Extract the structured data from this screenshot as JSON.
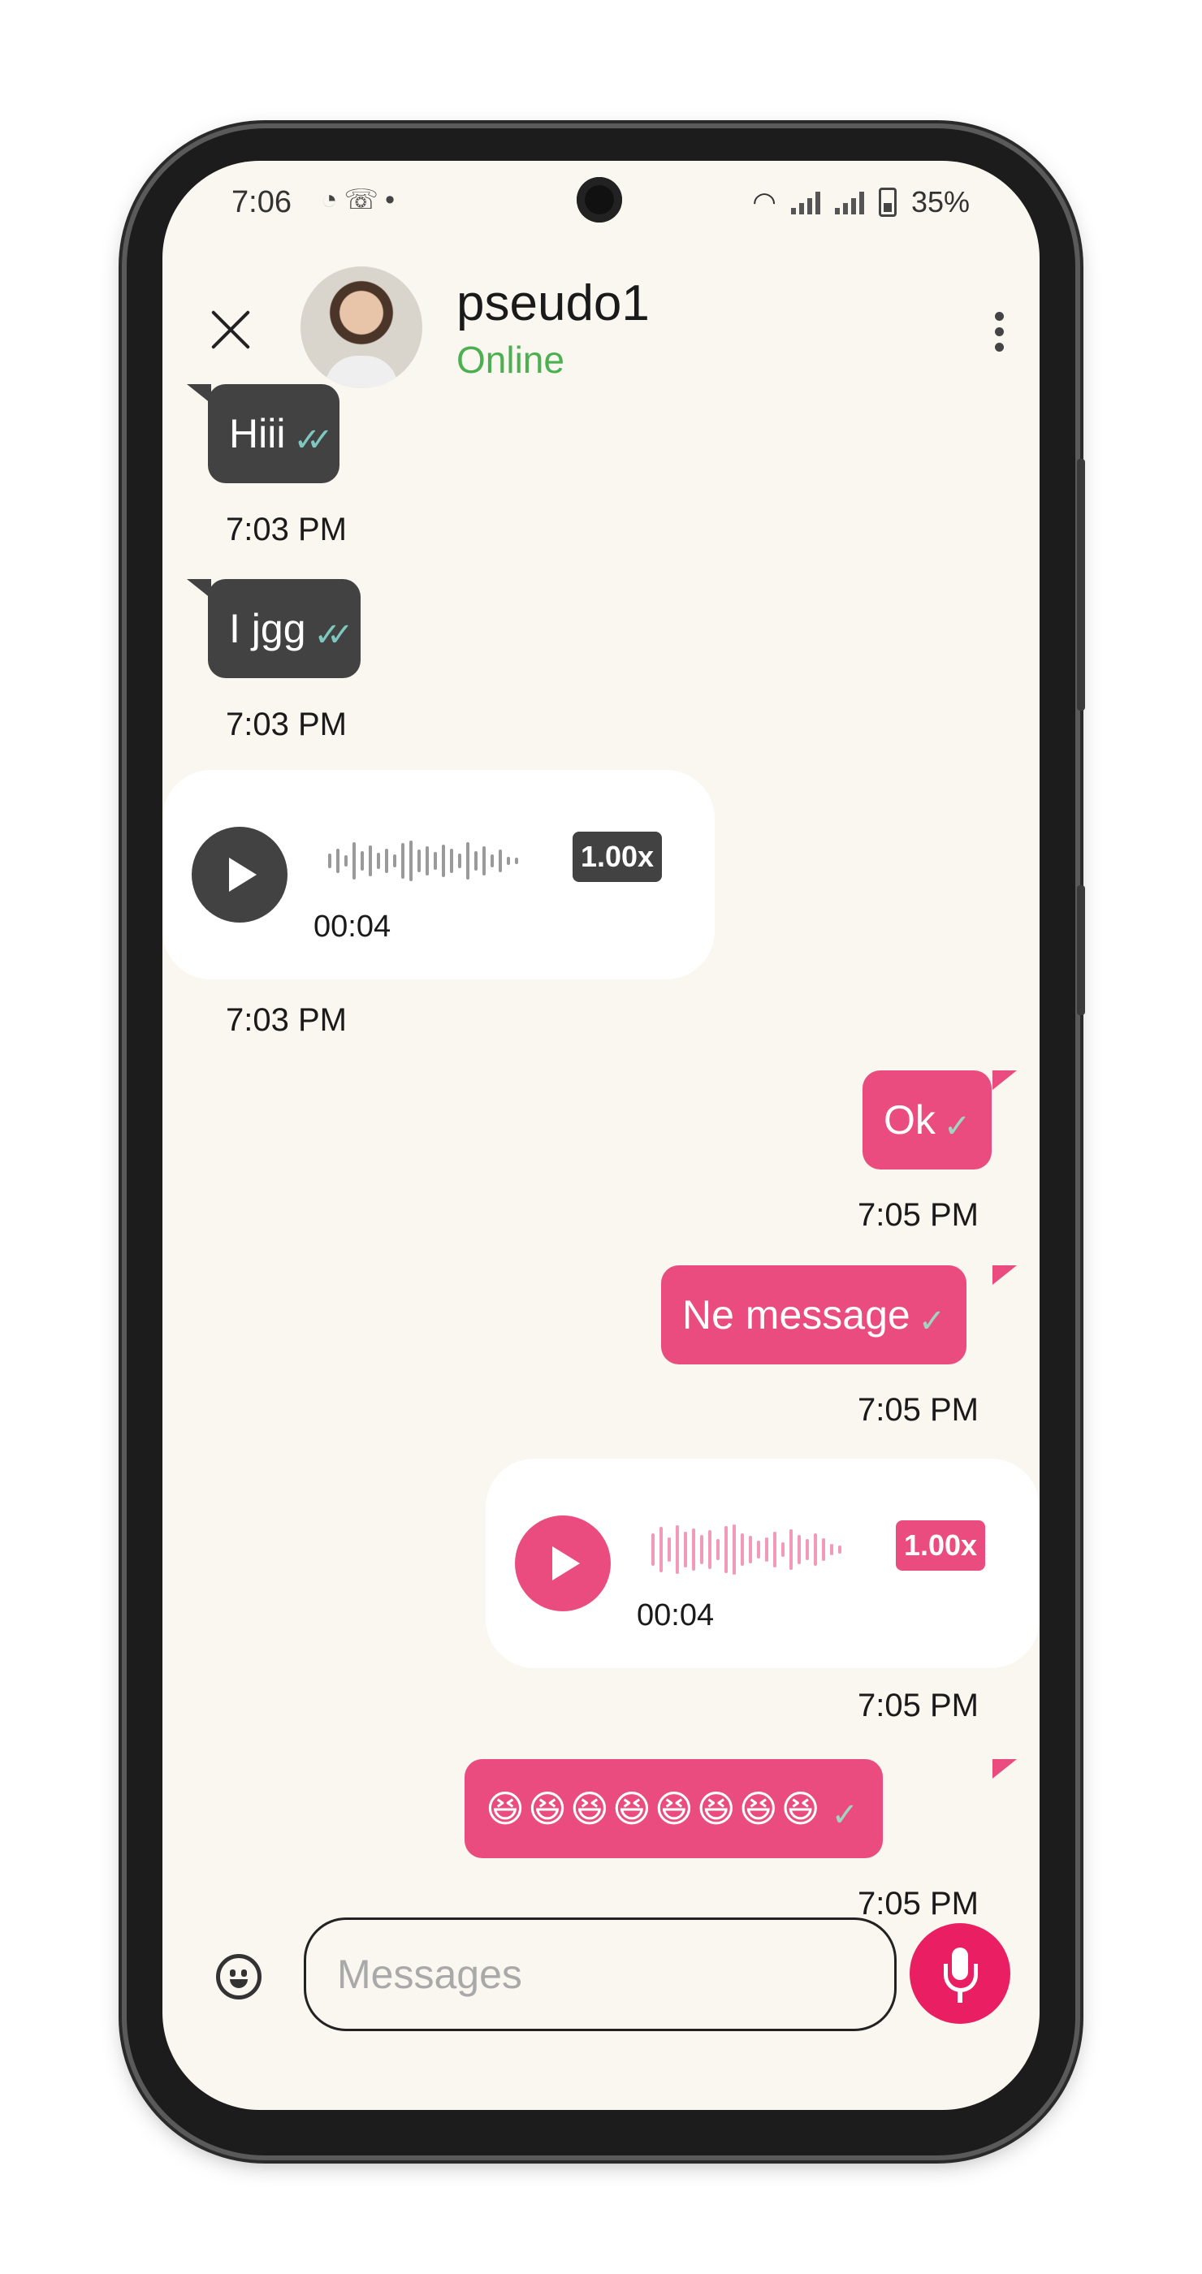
{
  "status_bar": {
    "time": "7:06",
    "notification_icons": [
      "messenger-icon",
      "viber-icon",
      "dot-icon"
    ],
    "battery": "35%"
  },
  "header": {
    "contact_name": "pseudo1",
    "contact_status": "Online",
    "status_color": "#4caf50"
  },
  "messages": [
    {
      "direction": "incoming",
      "type": "text",
      "text": "Hiii",
      "status": "read",
      "time": "7:03 PM"
    },
    {
      "direction": "incoming",
      "type": "text",
      "text": "I jgg",
      "status": "read",
      "time": "7:03 PM"
    },
    {
      "direction": "incoming",
      "type": "audio",
      "duration": "00:04",
      "speed": "1.00x",
      "time": "7:03 PM"
    },
    {
      "direction": "outgoing",
      "type": "text",
      "text": "Ok",
      "status": "sent",
      "time": "7:05 PM"
    },
    {
      "direction": "outgoing",
      "type": "text",
      "text": "Ne message",
      "status": "sent",
      "time": "7:05 PM"
    },
    {
      "direction": "outgoing",
      "type": "audio",
      "duration": "00:04",
      "speed": "1.00x",
      "time": "7:05 PM"
    },
    {
      "direction": "outgoing",
      "type": "text",
      "text": "😆😆😆😆😆😆😆😆",
      "status": "sent",
      "time": "7:05 PM"
    }
  ],
  "composer": {
    "placeholder": "Messages"
  },
  "colors": {
    "background": "#faf7f0",
    "incoming_bubble": "#424242",
    "outgoing_bubble": "#ea4c7f",
    "mic_button": "#e91e63"
  }
}
